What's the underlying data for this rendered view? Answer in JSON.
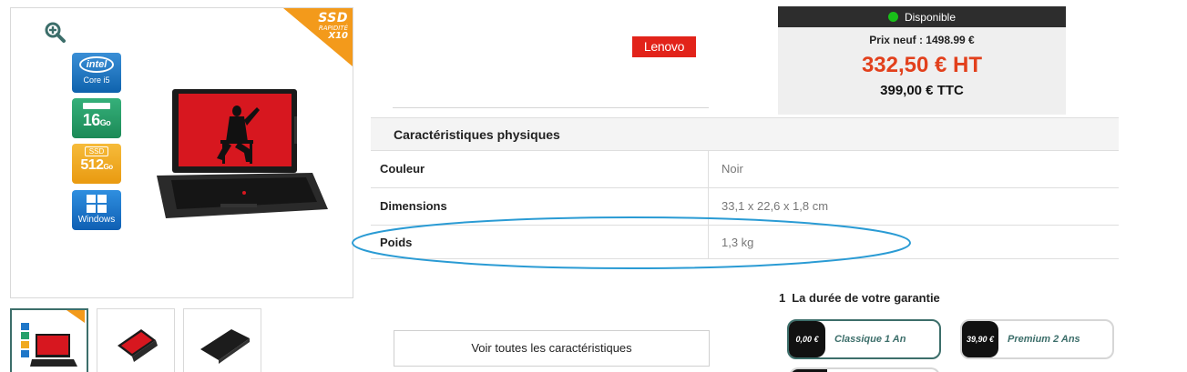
{
  "gallery": {
    "ssd_banner": {
      "line1": "SSD",
      "line2": "RAPIDITÉ",
      "line3": "X10"
    },
    "badges": {
      "intel": {
        "logo": "intel",
        "sub": "Core i5"
      },
      "ram": {
        "value": "16",
        "unit": "Go",
        "sub": "RAM"
      },
      "ssd": {
        "label": "SSD",
        "value": "512",
        "unit": "Go"
      },
      "windows": {
        "sub": "Windows"
      }
    },
    "thumbnail_count": 3,
    "active_thumbnail": 1
  },
  "brand": {
    "name": "Lenovo"
  },
  "price": {
    "status": "Disponible",
    "status_color": "#19c019",
    "new_price": "Prix neuf : 1498.99 €",
    "price_ht": "332,50 € HT",
    "price_ttc": "399,00 € TTC",
    "accent_color": "#e2401c"
  },
  "specs": {
    "section_title": "Caractéristiques physiques",
    "rows": [
      {
        "key": "Couleur",
        "value": "Noir"
      },
      {
        "key": "Dimensions",
        "value": "33,1 x 22,6 x 1,8 cm"
      },
      {
        "key": "Poids",
        "value": "1,3 kg"
      }
    ],
    "see_all_label": "Voir toutes les caractéristiques"
  },
  "warranty": {
    "step_number": "1",
    "title": "La durée de votre garantie",
    "options": [
      {
        "price": "0,00 €",
        "label": "Classique 1 An",
        "selected": true
      },
      {
        "price": "39,90 €",
        "label": "Premium 2 Ans",
        "selected": false
      }
    ]
  },
  "annotation": {
    "ellipse_color": "#2a9bd4"
  }
}
